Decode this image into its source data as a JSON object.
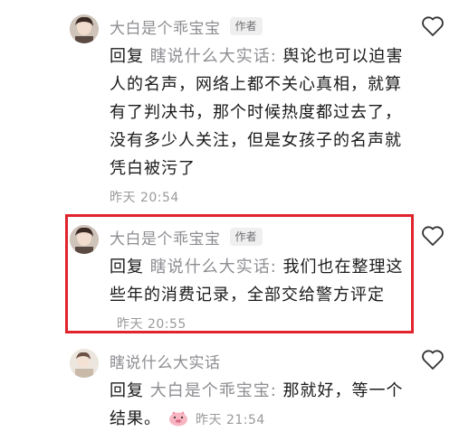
{
  "comments": [
    {
      "username": "大白是个乖宝宝",
      "badge": "作者",
      "reply_word": "回复",
      "reply_to": "瞎说什么大实话",
      "separator": ": ",
      "text": "舆论也可以迫害人的名声，网络上都不关心真相，就算有了判决书，那个时候热度都过去了，没有多少人关注，但是女孩子的名声就凭白被污了",
      "timestamp": "昨天 20:54"
    },
    {
      "username": "大白是个乖宝宝",
      "badge": "作者",
      "reply_word": "回复",
      "reply_to": "瞎说什么大实话",
      "separator": ": ",
      "text": "我们也在整理这些年的消费记录，全部交给警方评定",
      "timestamp": "昨天 20:55",
      "highlighted": true
    },
    {
      "username": "瞎说什么大实话",
      "reply_word": "回复",
      "reply_to": "大白是个乖宝宝",
      "separator": ": ",
      "text": "那就好，等一个结果。",
      "emoji": "pig-face-emoji",
      "timestamp": "昨天 21:54"
    }
  ],
  "colors": {
    "highlight_border": "#e0232c",
    "muted_text": "#8e8e93",
    "body_text": "#1a1a1a"
  },
  "icons": {
    "like": "heart-outline-icon",
    "avatar": "avatar"
  }
}
